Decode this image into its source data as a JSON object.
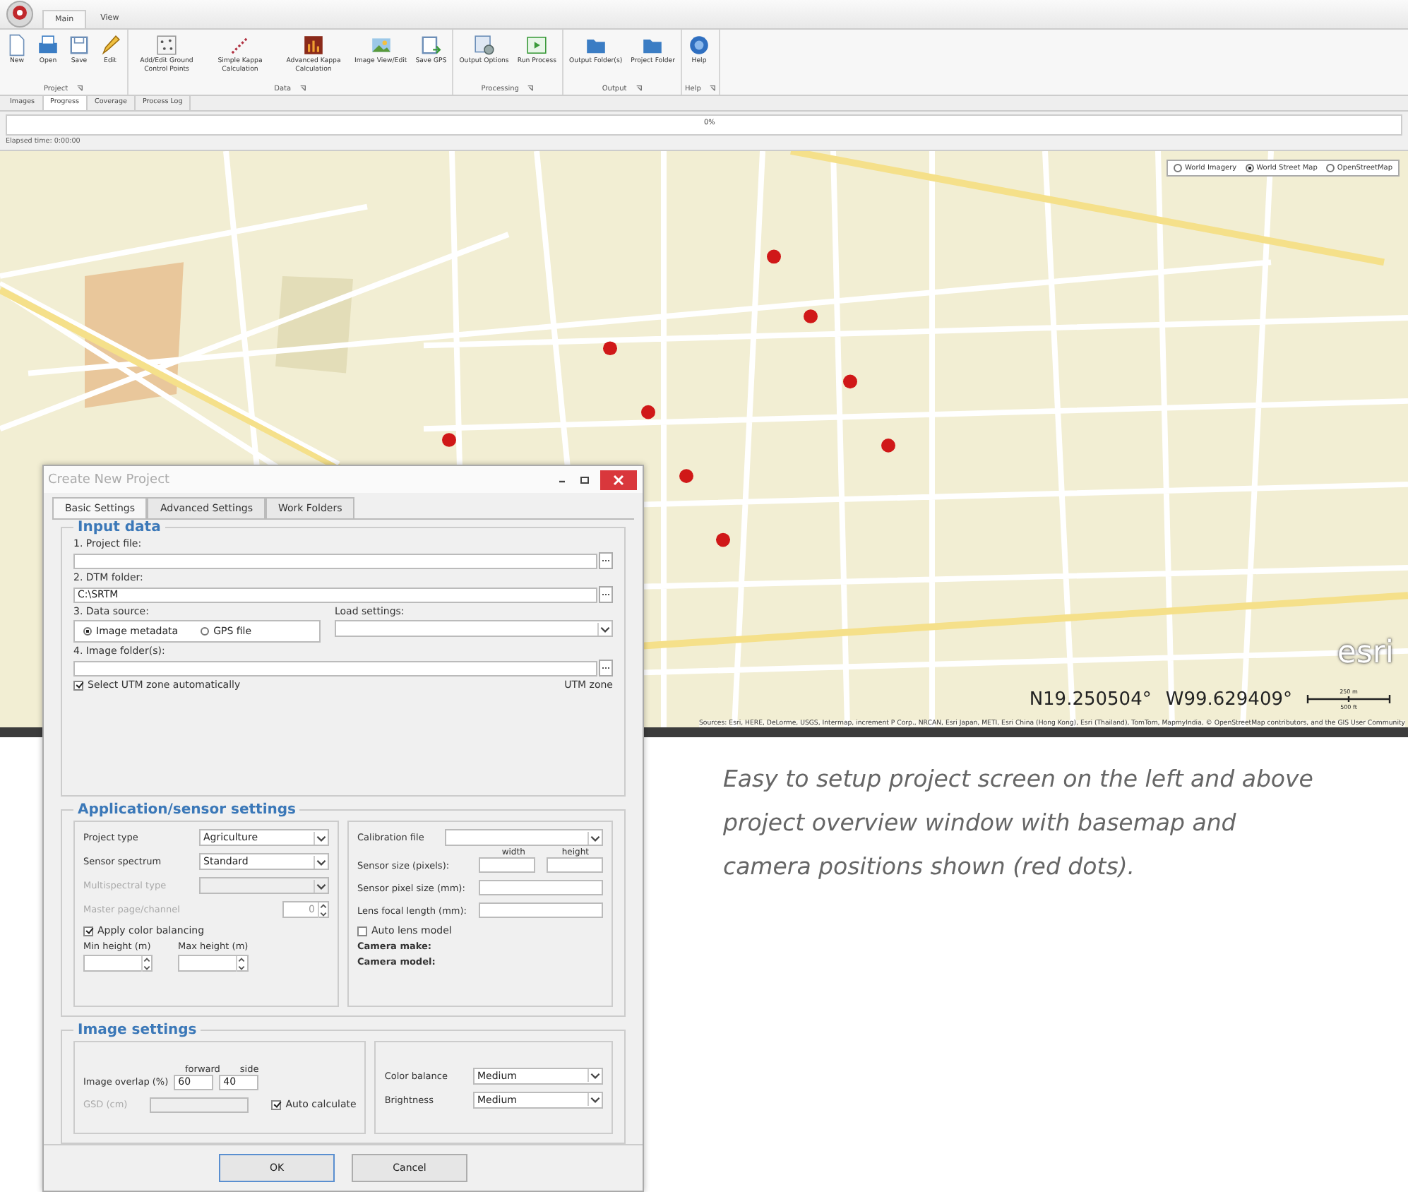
{
  "app": {
    "menu_tabs": [
      {
        "label": "Main",
        "selected": true
      },
      {
        "label": "View",
        "selected": false
      }
    ],
    "ribbon_groups": [
      {
        "label": "Project",
        "buttons": [
          {
            "label": "New",
            "kind": "new"
          },
          {
            "label": "Open",
            "kind": "open"
          },
          {
            "label": "Save",
            "kind": "save"
          },
          {
            "label": "Edit",
            "kind": "edit"
          }
        ]
      },
      {
        "label": "Data",
        "buttons": [
          {
            "label": "Add/Edit Ground Control Points",
            "kind": "gcp"
          },
          {
            "label": "Simple Kappa Calculation",
            "kind": "kappa"
          },
          {
            "label": "Advanced Kappa Calculation",
            "kind": "chart"
          },
          {
            "label": "Image View/Edit",
            "kind": "image"
          },
          {
            "label": "Save GPS",
            "kind": "savegps"
          }
        ]
      },
      {
        "label": "Processing",
        "buttons": [
          {
            "label": "Output Options",
            "kind": "options"
          },
          {
            "label": "Run Process",
            "kind": "run"
          }
        ]
      },
      {
        "label": "Output",
        "buttons": [
          {
            "label": "Output Folder(s)",
            "kind": "folder"
          },
          {
            "label": "Project Folder",
            "kind": "folder"
          }
        ]
      },
      {
        "label": "Help",
        "buttons": [
          {
            "label": "Help",
            "kind": "help"
          }
        ]
      }
    ],
    "view_tabs": [
      {
        "label": "Images",
        "selected": false
      },
      {
        "label": "Progress",
        "selected": true
      },
      {
        "label": "Coverage",
        "selected": false
      },
      {
        "label": "Process Log",
        "selected": false
      }
    ],
    "progress": {
      "level": 0,
      "reading": "0%"
    },
    "elapsed": "Elapsed time: 0:00:00",
    "map": {
      "basemaps": [
        {
          "label": "World Imagery",
          "selected": false
        },
        {
          "label": "World Street Map",
          "selected": true
        },
        {
          "label": "OpenStreetMap",
          "selected": false
        }
      ],
      "logo": "esri",
      "coordinates": [
        "N19.250504°",
        "W99.629409°"
      ],
      "scale": [
        "250 m",
        "500 ft"
      ],
      "attribution": "Sources: Esri, HERE, DeLorme, USGS, Intermap, increment P Corp., NRCAN, Esri Japan, METI, Esri China (Hong Kong), Esri (Thailand), TomTom, MapmyIndia, © OpenStreetMap contributors, and the GIS User Community"
    }
  },
  "dialog": {
    "title": "Create New Project",
    "tabs": [
      {
        "label": "Basic Settings",
        "selected": true
      },
      {
        "label": "Advanced Settings",
        "selected": false
      },
      {
        "label": "Work Folders",
        "selected": false
      }
    ],
    "input_data": {
      "title": "Input data",
      "project_file": {
        "label": "1. Project file:"
      },
      "dtm_folder": {
        "label": "2. DTM folder:",
        "value": "C:\\SRTM"
      },
      "data_source": {
        "label": "3. Data source:",
        "options": [
          {
            "label": "Image metadata",
            "selected": true
          },
          {
            "label": "GPS file",
            "selected": false
          }
        ]
      },
      "load_settings": {
        "label": "Load settings:"
      },
      "image_folders": {
        "label": "4. Image folder(s):"
      },
      "utm_auto": {
        "label": "Select UTM zone automatically",
        "checked": true
      },
      "utm_zone": "UTM zone"
    },
    "app_sensor": {
      "title": "Application/sensor settings",
      "left": [
        {
          "kind": "select",
          "label": "Project type",
          "value": "Agriculture",
          "disabled": false
        },
        {
          "kind": "select",
          "label": "Sensor spectrum",
          "value": "Standard",
          "disabled": false
        },
        {
          "kind": "select",
          "label": "Multispectral type",
          "disabled": true
        },
        {
          "kind": "spin",
          "label": "Master page/channel",
          "value": "0",
          "disabled": true
        }
      ],
      "color_balancing": {
        "label": "Apply color balancing",
        "checked": true
      },
      "heights": [
        "Min height (m)",
        "Max height (m)"
      ],
      "calibration": {
        "label": "Calibration file"
      },
      "sensor_size": {
        "label": "Sensor size (pixels):",
        "columns": [
          "width",
          "height"
        ]
      },
      "pixel_size": {
        "label": "Sensor pixel size  (mm):"
      },
      "focal_length": {
        "label": "Lens focal length (mm):"
      },
      "auto_lens": {
        "label": "Auto lens model",
        "checked": false
      },
      "camera": [
        "Camera make:",
        "Camera model:"
      ]
    },
    "image_settings": {
      "title": "Image settings",
      "overlap": {
        "label": "Image overlap (%)",
        "columns": [
          "forward",
          "side"
        ],
        "values": [
          "60",
          "40"
        ]
      },
      "gsd": {
        "label": "GSD (cm)",
        "disabled": true
      },
      "auto_calculate": {
        "label": "Auto calculate",
        "checked": true
      },
      "selects": [
        {
          "label": "Color balance",
          "value": "Medium"
        },
        {
          "label": "Brightness",
          "value": "Medium"
        }
      ]
    },
    "buttons": [
      "OK",
      "Cancel"
    ]
  },
  "caption": "Easy to setup project screen on the left and above project overview window with basemap and camera positions shown (red dots)."
}
